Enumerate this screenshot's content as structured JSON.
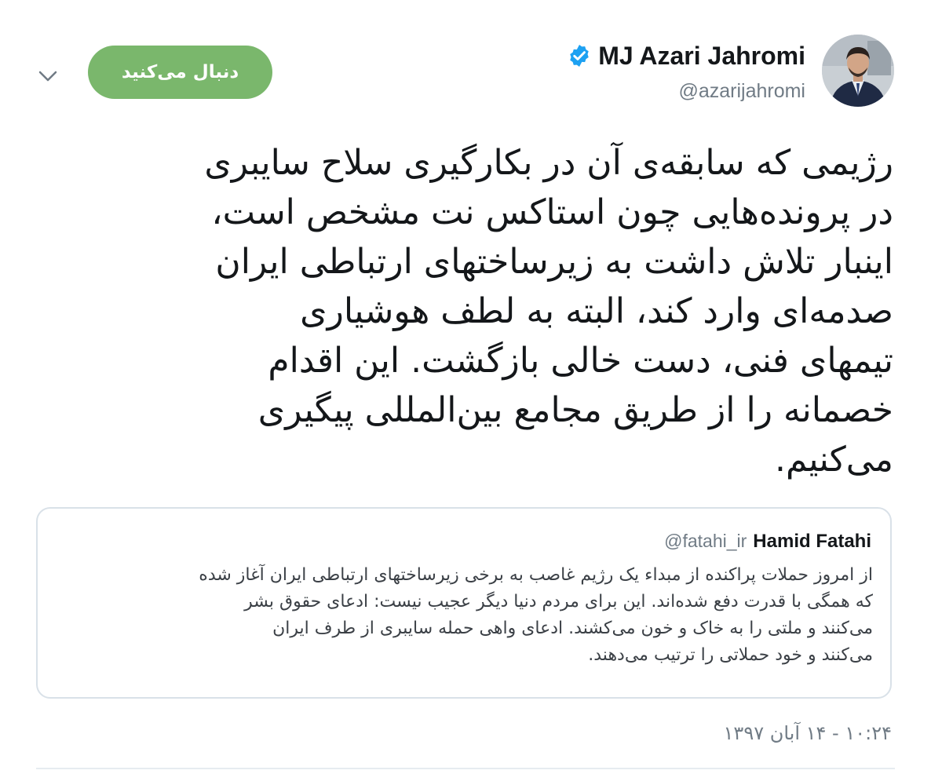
{
  "header": {
    "follow_button_label": "دنبال می‌کنید",
    "more_icon": "chevron-down-icon"
  },
  "author": {
    "display_name": "MJ Azari Jahromi",
    "handle": "@azarijahromi",
    "verified": true,
    "verified_icon": "verified-badge-icon",
    "verified_color": "#1da1f2"
  },
  "tweet": {
    "text": "رژیمی که سابقه‌ی آن در بکارگیری سلاح سایبری\nدر پرونده‌هایی چون استاکس نت مشخص است،\nاینبار تلاش داشت به زیرساختهای ارتباطی ایران\nصدمه‌ای وارد کند، البته به لطف هوشیاری\nتیمهای فنی، دست خالی بازگشت. این اقدام\nخصمانه را از طریق مجامع بین‌المللی پیگیری\nمی‌کنیم.",
    "timestamp": "۱۰:۲۴ - ۱۴ آبان ۱۳۹۷"
  },
  "quoted_tweet": {
    "display_name": "Hamid Fatahi",
    "handle": "@fatahi_ir",
    "text": "از امروز حملات پراکنده از مبداء یک رژیم غاصب به برخی زیرساختهای ارتباطی ایران آغاز شده\nکه همگی با قدرت دفع شده‌اند. این برای مردم دنیا دیگر عجیب نیست: ادعای حقوق بشر\nمی‌کنند و ملتی را به خاک و خون می‌کشند. ادعای واهی حمله سایبری از طرف ایران\nمی‌کنند و خود حملاتی را ترتیب می‌دهند."
  },
  "colors": {
    "follow_button_bg": "#7ab76c",
    "text_primary": "#14171a",
    "text_secondary": "#707b85",
    "border": "#d9e1e8"
  }
}
